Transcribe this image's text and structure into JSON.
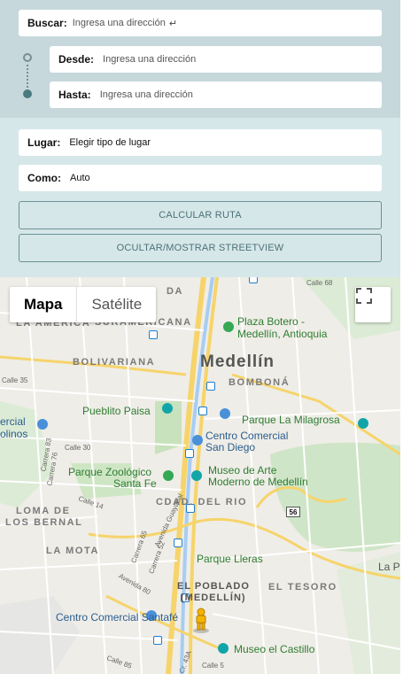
{
  "search": {
    "label": "Buscar:",
    "placeholder": "Ingresa una dirección",
    "enter_icon": "return-arrow-icon"
  },
  "from": {
    "label": "Desde:",
    "placeholder": "Ingresa una dirección"
  },
  "to": {
    "label": "Hasta:",
    "placeholder": "Ingresa una dirección"
  },
  "place": {
    "label": "Lugar:",
    "value": "Elegir tipo de lugar"
  },
  "mode": {
    "label": "Como:",
    "value": "Auto"
  },
  "buttons": {
    "calculate": "CALCULAR RUTA",
    "toggle_streetview": "OCULTAR/MOSTRAR STREETVIEW"
  },
  "map": {
    "type_options": [
      "Mapa",
      "Satélite"
    ],
    "labels": {
      "city": "Medellín",
      "plaza_botero_1": "Plaza Botero -",
      "plaza_botero_2": "Medellín, Antioquia",
      "la_america": "LA AMERICA",
      "suramericana": "SURAMERICANA",
      "da": "DA",
      "bolivariana": "BOLIVARIANA",
      "bombona": "BOMBONÁ",
      "pueblito_paisa": "Pueblito Paisa",
      "parque_milagrosa": "Parque La Milagrosa",
      "cc_san_diego_1": "Centro Comercial",
      "cc_san_diego_2": "San Diego",
      "ercial": "ercial",
      "olinos": "olinos",
      "zoo_1": "Parque Zoológico",
      "zoo_2": "Santa Fe",
      "museo_arte_1": "Museo de Arte",
      "museo_arte_2": "Moderno de Medellín",
      "ciudad_del_rio": "CDAD. DEL RIO",
      "loma_1": "LOMA DE",
      "loma_2": "LOS BERNAL",
      "la_mota": "LA MOTA",
      "parque_lleras": "Parque Lleras",
      "la_p": "La P",
      "poblado_1": "EL POBLADO",
      "poblado_2": "(MEDELLÍN)",
      "el_tesoro": "EL TESORO",
      "santafe": "Centro Comercial Santafé",
      "museo_castillo": "Museo el Castillo",
      "calle_68": "Calle 68",
      "calle_35": "Calle 35",
      "calle_30": "Calle 30",
      "carrera_83": "Carrera 83",
      "carrera_76": "Carrera 76",
      "calle_14": "Calle 14",
      "avenida_guayabal": "Avenida Guayabal",
      "carrera_65": "Carrera 65",
      "carrera_52": "Carrera 52",
      "avenida_80": "Avenida 80",
      "calle_85": "Calle 85",
      "calle_5": "Calle 5",
      "cr_43a": "Cr. 43A",
      "route_56": "56"
    }
  }
}
